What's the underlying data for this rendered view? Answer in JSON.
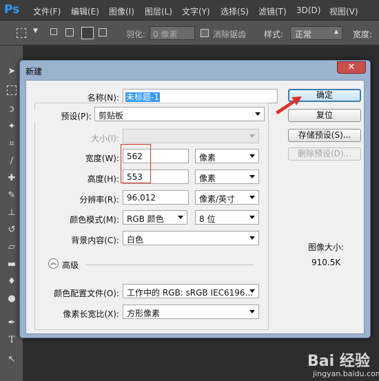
{
  "app": {
    "logo": "Ps",
    "menu": [
      "文件(F)",
      "编辑(E)",
      "图像(I)",
      "图层(L)",
      "文字(Y)",
      "选择(S)",
      "滤镜(T)",
      "3D(D)",
      "视图(V)"
    ]
  },
  "options_bar": {
    "feather_label": "羽化:",
    "feather_value": "0 像素",
    "antialias_label": "消除锯齿",
    "style_label": "样式:",
    "style_value": "正常",
    "width_label": "宽度:"
  },
  "dialog": {
    "title": "新建",
    "close_glyph": "✕",
    "name_label": "名称(N):",
    "name_value": "未标题-1",
    "preset_label": "预设(P):",
    "preset_value": "剪贴板",
    "size_label": "大小(I):",
    "size_value": "",
    "width_label": "宽度(W):",
    "width_value": "562",
    "width_unit": "像素",
    "height_label": "高度(H):",
    "height_value": "553",
    "height_unit": "像素",
    "resolution_label": "分辨率(R):",
    "resolution_value": "96.012",
    "resolution_unit": "像素/英寸",
    "color_mode_label": "颜色模式(M):",
    "color_mode_value": "RGB 颜色",
    "bit_depth_value": "8 位",
    "background_label": "背景内容(C):",
    "background_value": "白色",
    "advanced_label": "高级",
    "advanced_glyph": "︽",
    "color_profile_label": "颜色配置文件(O):",
    "color_profile_value": "工作中的 RGB: sRGB IEC6196...",
    "pixel_aspect_label": "像素长宽比(X):",
    "pixel_aspect_value": "方形像素",
    "ok_button": "确定",
    "reset_button": "复位",
    "save_preset_button": "存储预设(S)...",
    "delete_preset_button": "删除预设(D)...",
    "image_size_label": "图像大小:",
    "image_size_value": "910.5K"
  },
  "watermark": {
    "logo": "Bai 经验",
    "url": "jingyan.baidu.com"
  },
  "colors": {
    "annotation_red": "#d9342b",
    "dialog_frame": "#9ab3cf",
    "ps_dark": "#3c3c3c"
  }
}
